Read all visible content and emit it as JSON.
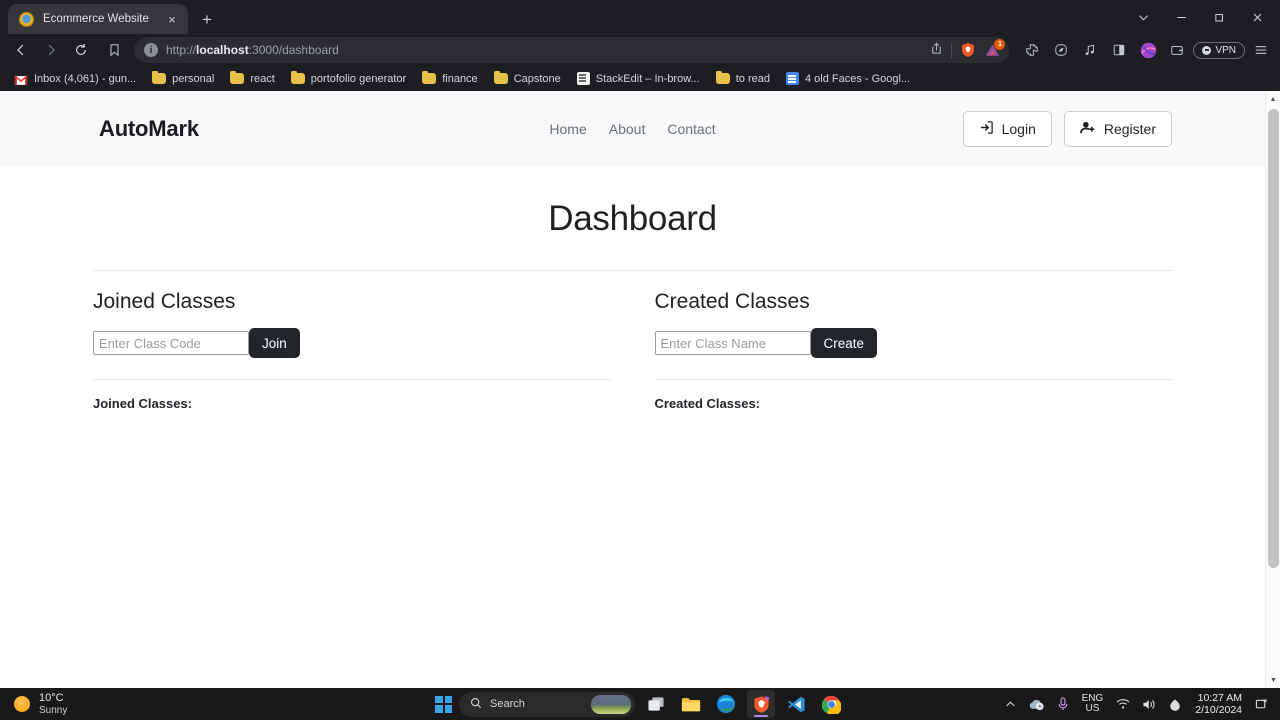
{
  "browser": {
    "tab": {
      "title": "Ecommerce Website",
      "favicon": "globe-favicon",
      "close": "×"
    },
    "new_tab": "+",
    "window_controls": {
      "tab_search": "⌄",
      "minimize": "–",
      "maximize": "❐",
      "close": "✕"
    },
    "nav": {
      "back": "‹",
      "forward": "›",
      "reload": "↻",
      "bookmark": "☐"
    },
    "omnibox": {
      "info_icon": "i",
      "url_scheme": "http://",
      "url_host": "localhost",
      "url_rest": ":3000/dashboard",
      "share_icon": "share-icon",
      "brave_icon": "brave-shields-icon",
      "extension_badge": "1"
    },
    "toolbar_icons": [
      "puzzle-icon",
      "leaf-icon",
      "music-note-icon",
      "split-view-icon",
      "profile-avatar-icon",
      "wallet-icon"
    ],
    "vpn_label": "VPN",
    "menu_icon": "hamburger-menu-icon",
    "bookmarks": [
      {
        "label": "Inbox (4,061) - gun...",
        "icon": "gmail-icon"
      },
      {
        "label": "personal",
        "icon": "folder-icon"
      },
      {
        "label": "react",
        "icon": "folder-icon"
      },
      {
        "label": "portofolio generator",
        "icon": "folder-icon"
      },
      {
        "label": "finance",
        "icon": "folder-icon"
      },
      {
        "label": "Capstone",
        "icon": "folder-icon"
      },
      {
        "label": "StackEdit – In-brow...",
        "icon": "stackedit-icon"
      },
      {
        "label": "to read",
        "icon": "folder-icon"
      },
      {
        "label": "4 old Faces - Googl...",
        "icon": "google-docs-icon"
      }
    ]
  },
  "page": {
    "navbar": {
      "brand": "AutoMark",
      "links": [
        {
          "label": "Home"
        },
        {
          "label": "About"
        },
        {
          "label": "Contact"
        }
      ],
      "login": {
        "label": "Login",
        "icon": "sign-in-icon"
      },
      "register": {
        "label": "Register",
        "icon": "user-plus-icon"
      }
    },
    "title": "Dashboard",
    "columns": [
      {
        "heading": "Joined Classes",
        "input_placeholder": "Enter Class Code",
        "input_value": "",
        "button_label": "Join",
        "list_label": "Joined Classes:",
        "list_items": []
      },
      {
        "heading": "Created Classes",
        "input_placeholder": "Enter Class Name",
        "input_value": "",
        "button_label": "Create",
        "list_label": "Created Classes:",
        "list_items": []
      }
    ],
    "colors": {
      "dark_button": "#222529",
      "navbar_bg": "#f8f9fa"
    }
  },
  "taskbar": {
    "weather": {
      "temperature": "10°C",
      "condition": "Sunny",
      "icon": "sun-icon"
    },
    "start": "windows-start-icon",
    "search": {
      "placeholder": "Search",
      "icon": "search-icon"
    },
    "apps": [
      "task-view-icon",
      "file-explorer-icon",
      "edge-icon",
      "brave-icon",
      "vscode-icon",
      "chrome-icon"
    ],
    "tray": {
      "overflow": "chevron-up-icon",
      "onedrive": "cloud-icon",
      "microphone": "microphone-icon",
      "language_line1": "ENG",
      "language_line2": "US",
      "wifi": "wifi-icon",
      "volume": "speaker-icon",
      "battery": "battery-icon",
      "time": "10:27 AM",
      "date": "2/10/2024",
      "notifications": "notification-icon"
    }
  }
}
